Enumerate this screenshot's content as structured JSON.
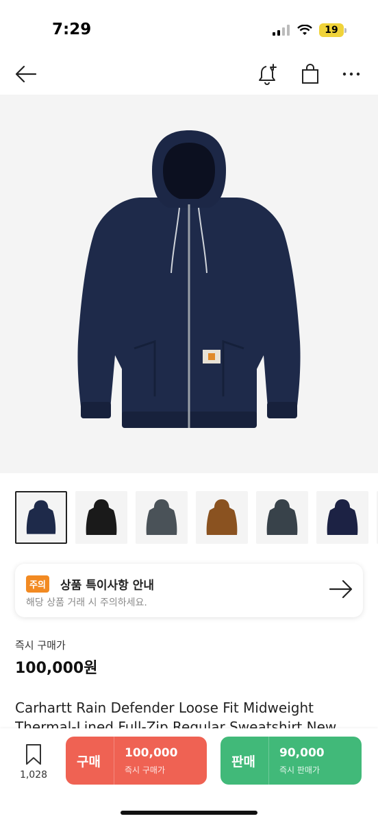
{
  "status": {
    "time": "7:29",
    "battery": "19"
  },
  "nav": {
    "back_icon": "back-arrow-icon",
    "bell_icon": "bell-plus-icon",
    "bag_icon": "shopping-bag-icon",
    "more_icon": "more-dots-icon"
  },
  "product": {
    "image_alt": "navy hooded zip jacket",
    "thumbnails": [
      {
        "color": "#1e2a4a",
        "label": "navy"
      },
      {
        "color": "#1a1a1a",
        "label": "black"
      },
      {
        "color": "#4a5258",
        "label": "gray"
      },
      {
        "color": "#8a5220",
        "label": "brown"
      },
      {
        "color": "#38424a",
        "label": "dark gray"
      },
      {
        "color": "#1c2244",
        "label": "dark navy"
      }
    ],
    "title": "Carhartt Rain Defender Loose Fit Midweight Thermal-Lined Full-Zip Regular Sweatshirt New"
  },
  "notice": {
    "badge": "주의",
    "title": "상품 특이사항 안내",
    "subtitle": "해당 상품 거래 시 주의하세요."
  },
  "price": {
    "label": "즉시 구매가",
    "value": "100,000원"
  },
  "bottom": {
    "wish_count": "1,028",
    "buy": {
      "label": "구매",
      "price": "100,000",
      "sub": "즉시 구매가"
    },
    "sell": {
      "label": "판매",
      "price": "90,000",
      "sub": "즉시 판매가"
    }
  },
  "colors": {
    "buy": "#ef6253",
    "sell": "#41b979",
    "notice_badge": "#f28a22"
  }
}
